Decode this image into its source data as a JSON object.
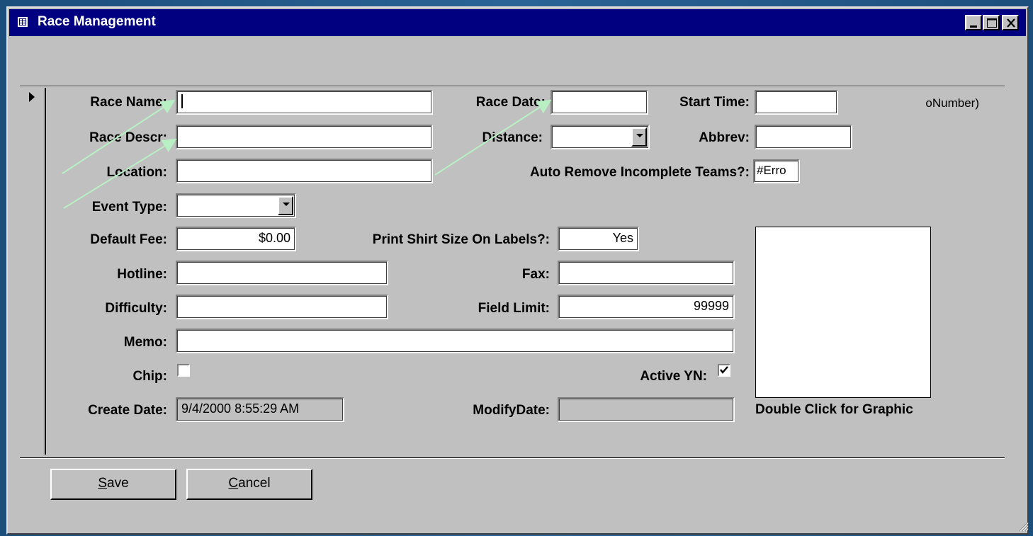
{
  "window": {
    "title": "Race Management"
  },
  "form": {
    "race_name": {
      "label": "Race Name:",
      "value": ""
    },
    "race_date": {
      "label": "Race Date:",
      "value": ""
    },
    "start_time": {
      "label": "Start Time:",
      "value": ""
    },
    "truncated_text": "oNumber)",
    "race_descr": {
      "label": "Race Descr:",
      "value": ""
    },
    "distance": {
      "label": "Distance:",
      "value": ""
    },
    "abbrev": {
      "label": "Abbrev:",
      "value": ""
    },
    "location": {
      "label": "Location:",
      "value": ""
    },
    "auto_remove": {
      "label": "Auto Remove Incomplete Teams?:",
      "value": "#Erro"
    },
    "event_type": {
      "label": "Event Type:",
      "value": ""
    },
    "default_fee": {
      "label": "Default Fee:",
      "value": "$0.00"
    },
    "print_shirt": {
      "label": "Print Shirt Size On Labels?:",
      "value": "Yes"
    },
    "hotline": {
      "label": "Hotline:",
      "value": ""
    },
    "fax": {
      "label": "Fax:",
      "value": ""
    },
    "difficulty": {
      "label": "Difficulty:",
      "value": ""
    },
    "field_limit": {
      "label": "Field Limit:",
      "value": "99999"
    },
    "memo": {
      "label": "Memo:",
      "value": ""
    },
    "chip": {
      "label": "Chip:",
      "checked": false
    },
    "active_yn": {
      "label": "Active YN:",
      "checked": true
    },
    "create_date": {
      "label": "Create Date:",
      "value": "9/4/2000 8:55:29 AM"
    },
    "modify_date": {
      "label": "ModifyDate:",
      "value": ""
    },
    "graphic_caption": "Double Click for Graphic"
  },
  "buttons": {
    "save": {
      "mnemonic": "S",
      "rest": "ave"
    },
    "cancel": {
      "mnemonic": "C",
      "rest": "ancel"
    }
  },
  "colors": {
    "titlebar": "#000080",
    "window_face": "#c0c0c0",
    "annotation_arrow": "#b8f0c4"
  }
}
